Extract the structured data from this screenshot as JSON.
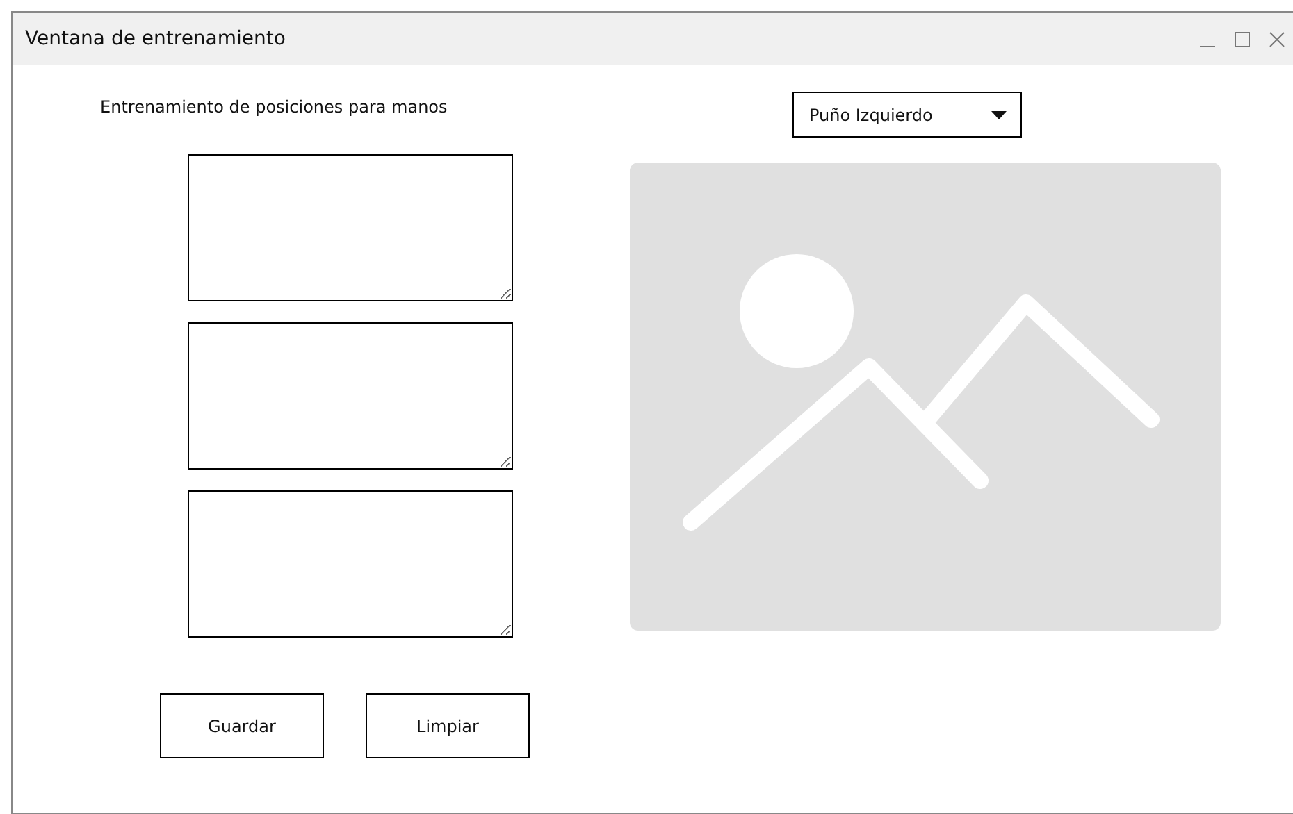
{
  "window": {
    "title": "Ventana de entrenamiento"
  },
  "heading": "Entrenamiento de posiciones para manos",
  "dropdown": {
    "value": "Puño Izquierdo"
  },
  "text_areas": [
    {
      "kind": "textarea"
    },
    {
      "kind": "textarea"
    },
    {
      "kind": "textarea"
    }
  ],
  "image": {
    "kind": "placeholder"
  },
  "buttons": [
    "Guardar",
    "Limpiar"
  ]
}
